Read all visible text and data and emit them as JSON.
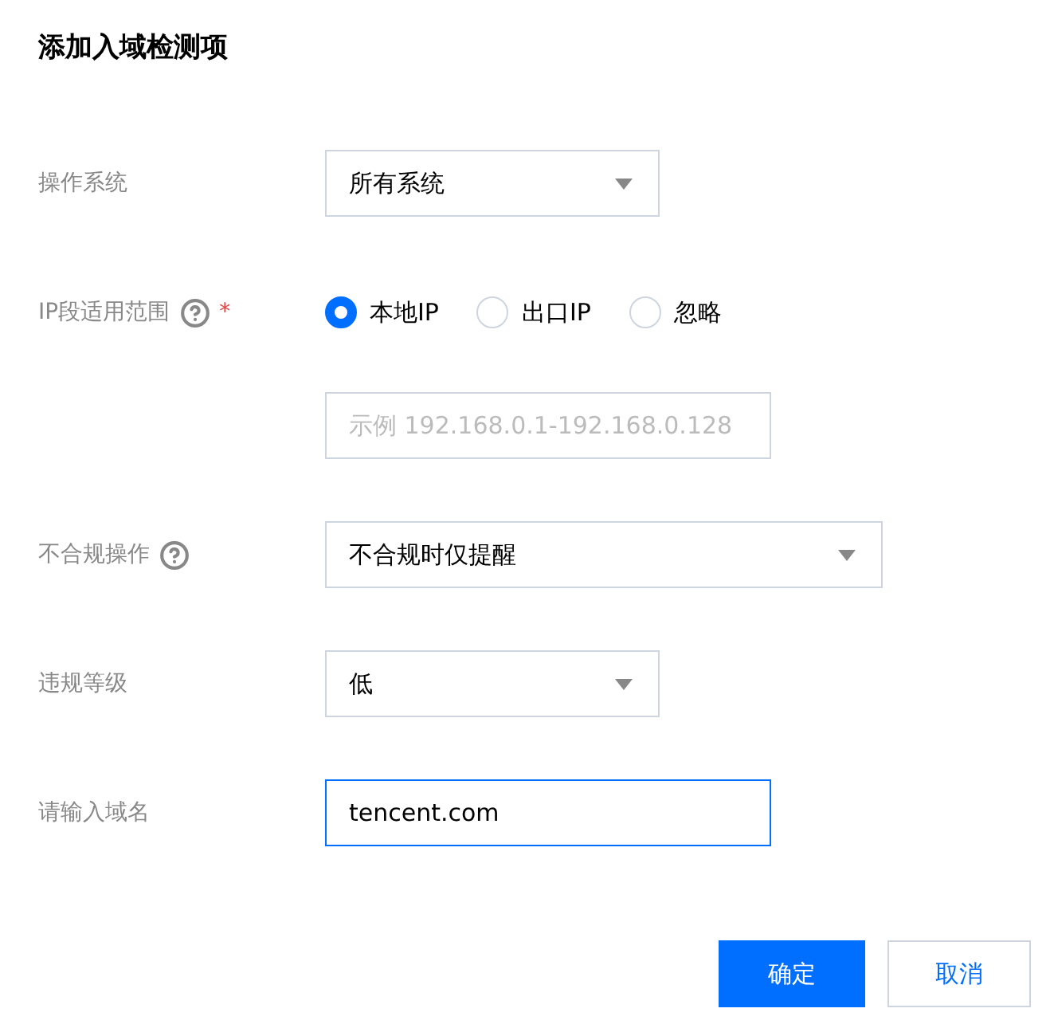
{
  "title": "添加入域检测项",
  "fields": [
    {
      "kind": "select",
      "label": "操作系统",
      "help": false,
      "value": "所有系统"
    },
    {
      "kind": "radio",
      "label": "IP段适用范围",
      "help": true,
      "required_mark": "*",
      "options": [
        {
          "label": "本地IP",
          "selected": true
        },
        {
          "label": "出口IP",
          "selected": false
        },
        {
          "label": "忽略",
          "selected": false
        }
      ]
    },
    {
      "kind": "input",
      "placeholder": "示例 192.168.0.1-192.168.0.128",
      "focused": false
    },
    {
      "kind": "select",
      "label": "不合规操作",
      "help": true,
      "value": "不合规时仅提醒"
    },
    {
      "kind": "select",
      "label": "违规等级",
      "help": false,
      "value": "低"
    },
    {
      "kind": "input",
      "label": "请输入域名",
      "value": "tencent.com",
      "focused": true
    }
  ],
  "buttons": [
    {
      "label": "确定",
      "kind": "primary"
    },
    {
      "label": "取消",
      "kind": "secondary"
    }
  ]
}
